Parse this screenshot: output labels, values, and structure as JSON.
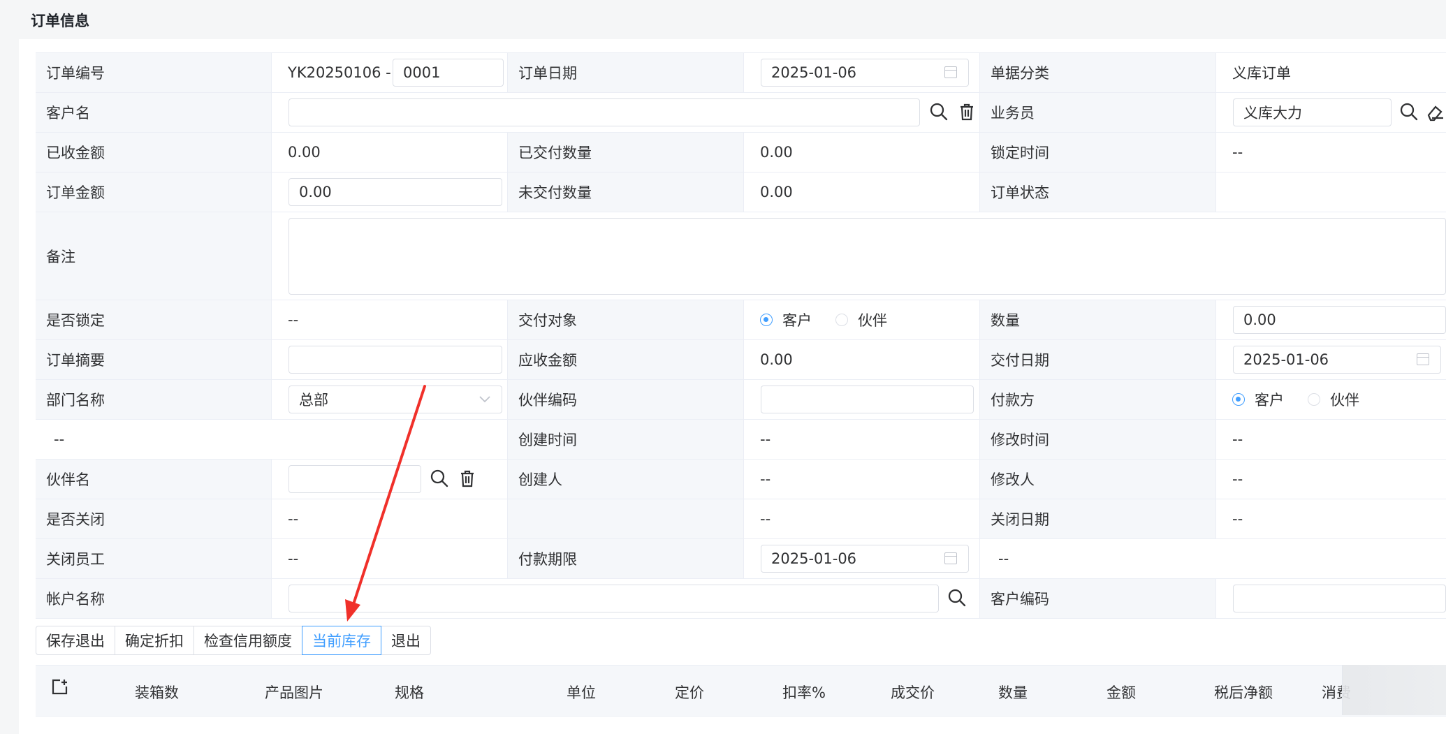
{
  "page": {
    "title": "订单信息"
  },
  "form": {
    "order_no_label": "订单编号",
    "order_no_prefix": "YK20250106 -",
    "order_no_suffix": "0001",
    "order_date_label": "订单日期",
    "order_date": "2025-01-06",
    "doc_type_label": "单据分类",
    "doc_type": "义库订单",
    "customer_name_label": "客户名",
    "customer_name": "",
    "salesperson_label": "业务员",
    "salesperson": "义库大力",
    "received_amount_label": "已收金额",
    "received_amount": "0.00",
    "delivered_qty_label": "已交付数量",
    "delivered_qty": "0.00",
    "lock_time_label": "锁定时间",
    "lock_time": "--",
    "order_amount_label": "订单金额",
    "order_amount": "0.00",
    "undelivered_qty_label": "未交付数量",
    "undelivered_qty": "0.00",
    "order_status_label": "订单状态",
    "order_status": "",
    "remark_label": "备注",
    "remark": "",
    "locked_label": "是否锁定",
    "locked": "--",
    "delivery_target_label": "交付对象",
    "delivery_target_opt1": "客户",
    "delivery_target_opt2": "伙伴",
    "quantity_label": "数量",
    "quantity": "0.00",
    "summary_label": "订单摘要",
    "summary": "",
    "receivable_label": "应收金额",
    "receivable": "0.00",
    "delivery_date_label": "交付日期",
    "delivery_date": "2025-01-06",
    "dept_label": "部门名称",
    "dept": "总部",
    "partner_code_label": "伙伴编码",
    "partner_code": "",
    "payer_label": "付款方",
    "payer_opt1": "客户",
    "payer_opt2": "伙伴",
    "blank_row_value": "--",
    "created_time_label": "创建时间",
    "created_time": "--",
    "modified_time_label": "修改时间",
    "modified_time": "--",
    "partner_name_label": "伙伴名",
    "partner_name": "",
    "creator_label": "创建人",
    "creator": "--",
    "modifier_label": "修改人",
    "modifier": "--",
    "closed_label": "是否关闭",
    "closed": "--",
    "unnamed_value": "--",
    "close_date_label": "关闭日期",
    "close_date": "--",
    "close_staff_label": "关闭员工",
    "close_staff": "--",
    "payment_term_label": "付款期限",
    "payment_term": "2025-01-06",
    "payment_term_extra": "--",
    "account_name_label": "帐户名称",
    "account_name": "",
    "customer_code_label": "客户编码",
    "customer_code": ""
  },
  "toolbar": {
    "save_exit": "保存退出",
    "confirm_discount": "确定折扣",
    "check_credit": "检查信用额度",
    "current_stock": "当前库存",
    "exit": "退出"
  },
  "table": {
    "columns": [
      "装箱数",
      "产品图片",
      "规格",
      "单位",
      "定价",
      "扣率%",
      "成交价",
      "数量",
      "金额",
      "税后净额",
      "消费"
    ]
  },
  "colors": {
    "accent": "#409eff",
    "annotation_arrow": "#f0302a"
  }
}
